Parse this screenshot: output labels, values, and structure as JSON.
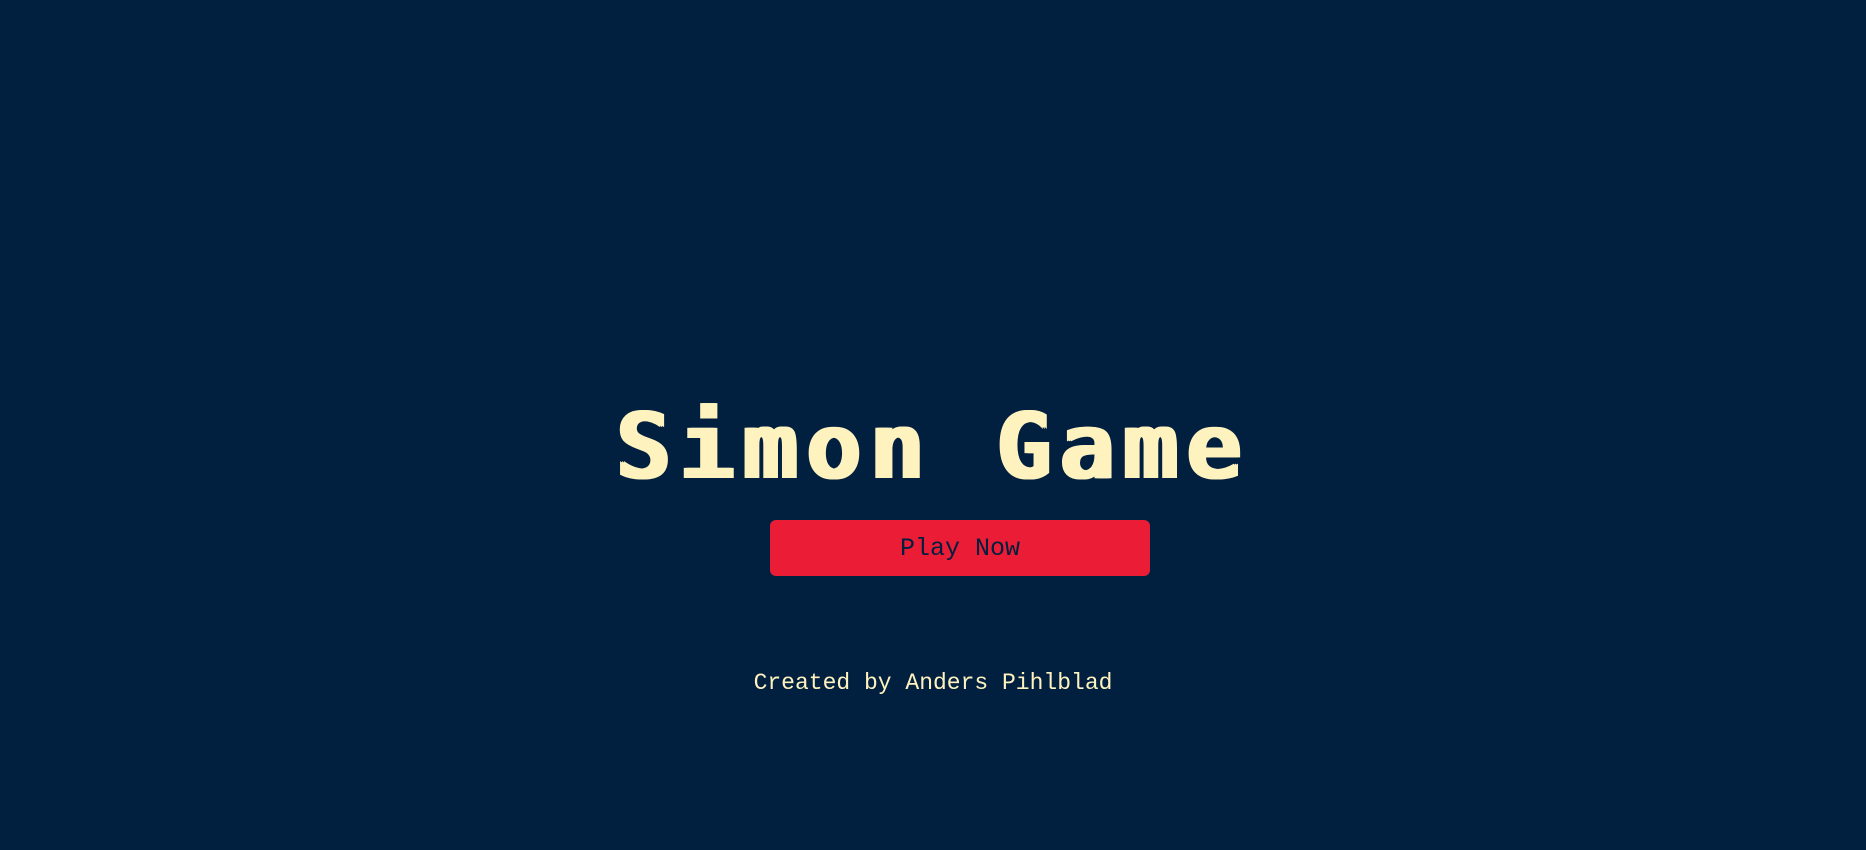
{
  "page": {
    "title": "Simon Game",
    "play_button_label": "Play Now",
    "credit": "Created by Anders Pihlblad"
  },
  "colors": {
    "background": "#011F3F",
    "title": "#FEF2BF",
    "button": "#EB1C36",
    "button_text": "#011F3F"
  }
}
